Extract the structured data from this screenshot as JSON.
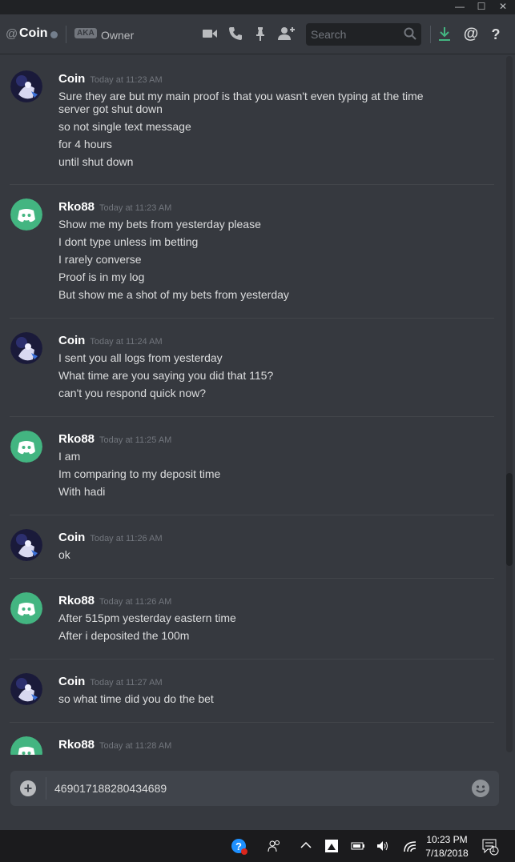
{
  "window": {
    "minimize": "—",
    "maximize": "☐",
    "close": "✕"
  },
  "header": {
    "at": "@",
    "channel": "Coin",
    "aka_badge": "AKA",
    "nickname": "Owner",
    "search_placeholder": "Search",
    "icons": [
      "video-icon",
      "phone-icon",
      "pin-icon",
      "add-friend-icon",
      "download-icon",
      "mention-icon",
      "help-icon"
    ]
  },
  "messages": [
    {
      "author": "Coin",
      "timestamp": "Today at 11:23 AM",
      "avatar": "coin",
      "lines": [
        "Sure they are but my main proof is that you wasn't even typing at the time",
        "server got shut down",
        "so not single text message",
        "for 4 hours",
        "until shut down"
      ]
    },
    {
      "author": "Rko88",
      "timestamp": "Today at 11:23 AM",
      "avatar": "discord",
      "lines": [
        "Show me my bets from yesterday please",
        "I dont type unless im betting",
        "I rarely converse",
        "Proof is in my log",
        "But show me a shot of my bets from yesterday"
      ]
    },
    {
      "author": "Coin",
      "timestamp": "Today at 11:24 AM",
      "avatar": "coin",
      "lines": [
        "I sent you all logs from yesterday",
        "What time are you saying you did that 115?",
        "can't you respond quick now?"
      ]
    },
    {
      "author": "Rko88",
      "timestamp": "Today at 11:25 AM",
      "avatar": "discord",
      "lines": [
        "I am",
        "Im comparing to my deposit time",
        "With hadi"
      ]
    },
    {
      "author": "Coin",
      "timestamp": "Today at 11:26 AM",
      "avatar": "coin",
      "lines": [
        "ok"
      ]
    },
    {
      "author": "Rko88",
      "timestamp": "Today at 11:26 AM",
      "avatar": "discord",
      "lines": [
        "After 515pm yesterday eastern time",
        "After i deposited the 100m"
      ]
    },
    {
      "author": "Coin",
      "timestamp": "Today at 11:27 AM",
      "avatar": "coin",
      "lines": [
        "so what time did you do the bet"
      ]
    },
    {
      "author": "Rko88",
      "timestamp": "Today at 11:28 AM",
      "avatar": "discord",
      "lines": []
    }
  ],
  "composer": {
    "value": "469017188280434689"
  },
  "taskbar": {
    "time": "10:23 PM",
    "date": "7/18/2018",
    "notification_count": "1"
  },
  "colors": {
    "discord_green": "#43b581",
    "bg": "#36393f",
    "coin_avatar": "#1a1a3a"
  }
}
